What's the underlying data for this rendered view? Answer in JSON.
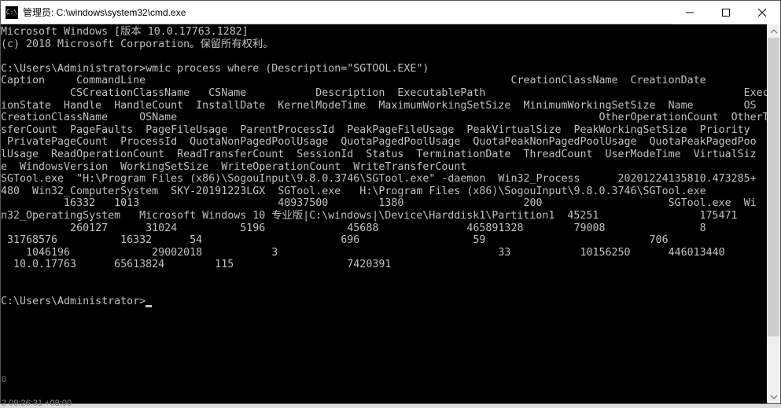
{
  "titlebar": {
    "icon_text": "C:\\",
    "title": "管理员: C:\\windows\\system32\\cmd.exe"
  },
  "terminal": {
    "line1": "Microsoft Windows [版本 10.0.17763.1282]",
    "line2": "(c) 2018 Microsoft Corporation。保留所有权利。",
    "line3": "",
    "line4": "C:\\Users\\Administrator>wmic process where (Description=\"SGTOOL.EXE\")",
    "line5": "Caption     CommandLine                                                          CreationClassName  CreationDate",
    "line6": "           CSCreationClassName   CSName           Description  ExecutablePath                                         Execut",
    "line7": "ionState  Handle  HandleCount  InstallDate  KernelModeTime  MaximumWorkingSetSize  MinimumWorkingSetSize  Name        OS",
    "line8": "CreationClassName     OSName                                                                   OtherOperationCount  OtherTran",
    "line9": "sferCount  PageFaults  PageFileUsage  ParentProcessId  PeakPageFileUsage  PeakVirtualSize  PeakWorkingSetSize  Priority ",
    "line10": " PrivatePageCount  ProcessId  QuotaNonPagedPoolUsage  QuotaPagedPoolUsage  QuotaPeakNonPagedPoolUsage  QuotaPeakPagedPoo",
    "line11": "lUsage  ReadOperationCount  ReadTransferCount  SessionId  Status  TerminationDate  ThreadCount  UserModeTime  VirtualSiz",
    "line12": "e  WindowsVersion  WorkingSetSize  WriteOperationCount  WriteTransferCount",
    "line13": "SGTool.exe  \"H:\\Program Files (x86)\\SogouInput\\9.8.0.3746\\SGTool.exe\" -daemon  Win32_Process      20201224135810.473285+",
    "line14": "480  Win32_ComputerSystem  SKY-20191223LGX  SGTool.exe   H:\\Program Files (x86)\\SogouInput\\9.8.0.3746\\SGTool.exe",
    "line15": "          16332   1013                      40937500        1380                   200                    SGTool.exe  Wi",
    "line16": "n32_OperatingSystem   Microsoft Windows 10 专业版|C:\\windows|\\Device\\Harddisk1\\Partition1  45251                175471",
    "line17": "           260127      31024          5196             45688              465891328        79008               8",
    "line18": " 31768576          16332      54                      696                  59                          706",
    "line19": "    1046196             29002018           3                                   33           10156250      446013440",
    "line20": "  10.0.17763      65613824        115                  7420391",
    "line21": "",
    "line22": "",
    "prompt": "C:\\Users\\Administrator>"
  },
  "status": {
    "line1": "0",
    "line2": "2 09:26:31 +08:00"
  }
}
